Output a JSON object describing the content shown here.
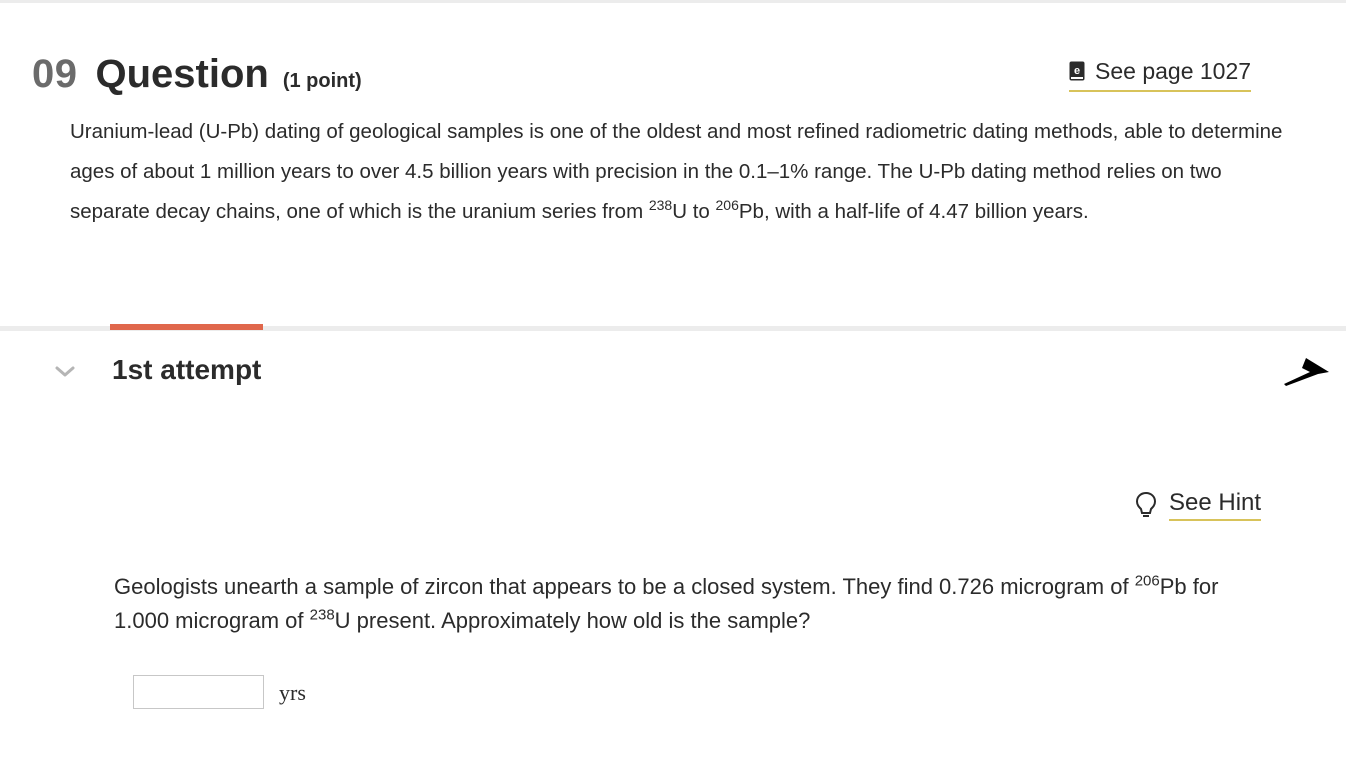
{
  "question": {
    "number": "09",
    "word": "Question",
    "points": "(1 point)"
  },
  "ebook_link": {
    "label": "See page 1027",
    "icon": "ebook-icon"
  },
  "intro": {
    "part1": "Uranium-lead (U-Pb) dating of geological samples is one of the oldest and most refined radiometric dating methods, able to determine ages of about 1 million years to over 4.5 billion years with precision in the 0.1–1% range. The U-Pb dating method relies on two separate decay chains, one of which is the uranium series from ",
    "sup1": "238",
    "part2": "U to ",
    "sup2": "206",
    "part3": "Pb, with a half-life of 4.47 billion years."
  },
  "attempt": {
    "label": "1st attempt",
    "tab_color": "#e0674c"
  },
  "hint": {
    "label": "See Hint",
    "icon": "lightbulb-icon"
  },
  "problem": {
    "part1": "Geologists unearth a sample of zircon that appears to be a closed system. They find 0.726 microgram of ",
    "sup1": "206",
    "part2": "Pb for 1.000 microgram of ",
    "sup2": "238",
    "part3": "U present. Approximately how old is the sample?"
  },
  "answer": {
    "value": "",
    "unit": "yrs"
  },
  "colors": {
    "link_underline": "#d8c35a",
    "accent": "#e0674c"
  }
}
